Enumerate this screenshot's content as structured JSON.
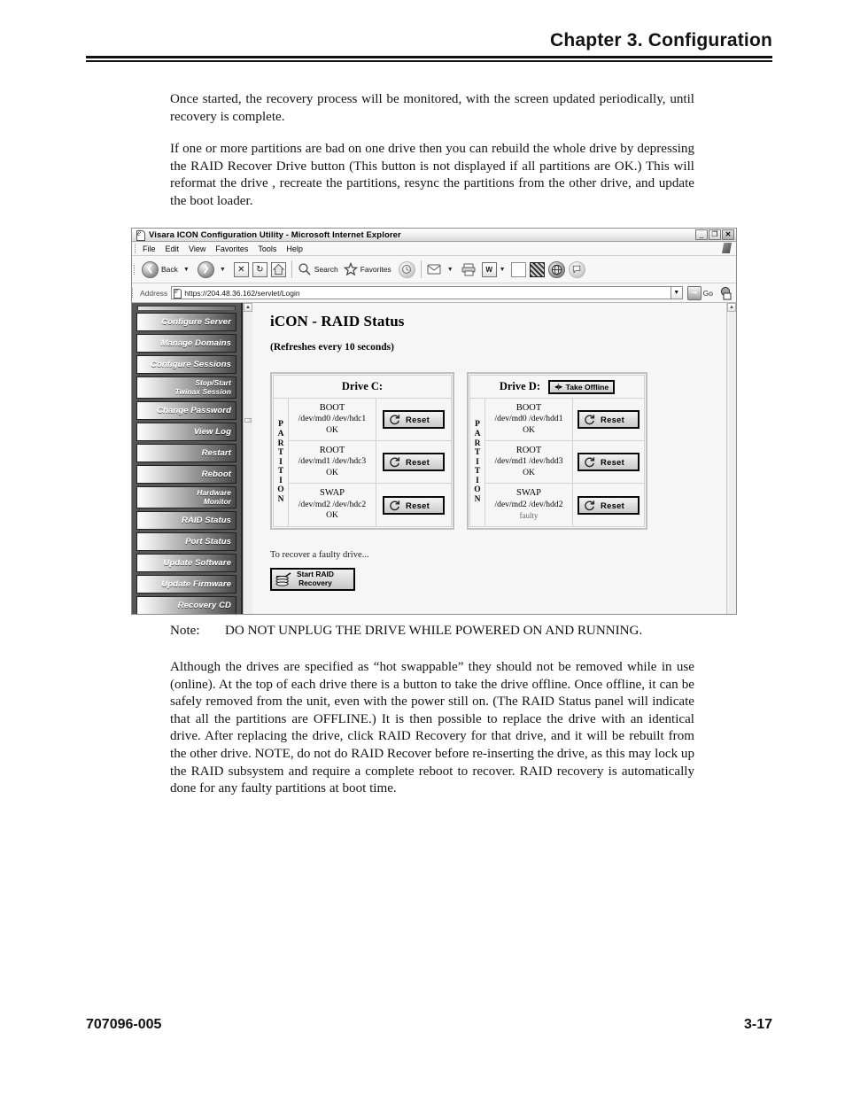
{
  "header": {
    "chapter_title": "Chapter 3.  Configuration"
  },
  "body": {
    "p1": "Once started, the recovery process will be monitored, with the screen updated periodically, until recovery is complete.",
    "p2": "If one or more partitions are bad on one drive then you can rebuild the whole drive by depressing the RAID Recover Drive button  (This button is not displayed if all partitions are OK.)  This will reformat the drive ,  recreate the partitions, resync the partitions from the other drive, and update the boot loader.",
    "note_label": "Note:",
    "note_text": "DO NOT UNPLUG THE DRIVE WHILE POWERED ON AND RUNNING.",
    "p3": "Although the drives are specified as “hot swappable” they should not be removed while in use (online). At the top of each drive there is a button to take the drive offline. Once offline, it can be safely removed from the unit, even with the power still on.  (The RAID Status panel will indicate that all the partitions are OFFLINE.)  It is then possible to replace the drive with an identical drive.  After replacing the drive, click RAID Recovery for that drive, and it will be rebuilt from the other drive. NOTE, do not do RAID Recover before re-inserting the drive, as this may lock up the RAID subsystem and require a complete reboot to recover.   RAID recovery is automatically done for any faulty partitions at boot time."
  },
  "footer": {
    "doc_number": "707096-005",
    "page_number": "3-17"
  },
  "browser": {
    "window_title": "Visara ICON Configuration Utility - Microsoft Internet Explorer",
    "window_buttons": {
      "minimize": "_",
      "restore": "❐",
      "close": "✕"
    },
    "menu": [
      "File",
      "Edit",
      "View",
      "Favorites",
      "Tools",
      "Help"
    ],
    "toolbar": {
      "back": "Back",
      "forward": "",
      "stop": "✕",
      "refresh": "↻",
      "home": "",
      "search": "Search",
      "favorites": "Favorites",
      "history": "",
      "mail": "",
      "print": "",
      "edit": "W",
      "discuss": "",
      "messenger": "",
      "research": ""
    },
    "address": {
      "label": "Address",
      "url": "https://204.48.36.162/servlet/Login",
      "go_label": "Go"
    }
  },
  "nav": {
    "items": [
      {
        "label": "Configure Server"
      },
      {
        "label": "Manage Domains"
      },
      {
        "label": "Configure Sessions"
      },
      {
        "label1": "Stop/Start",
        "label2": "Twinax Session"
      },
      {
        "label": "Change Password"
      },
      {
        "label": "View Log"
      },
      {
        "label": "Restart"
      },
      {
        "label": "Reboot"
      },
      {
        "label1": "Hardware",
        "label2": "Monitor"
      },
      {
        "label": "RAID Status"
      },
      {
        "label": "Port Status"
      },
      {
        "label": "Update Software"
      },
      {
        "label": "Update Firmware"
      },
      {
        "label": "Recovery CD"
      }
    ]
  },
  "app": {
    "title": "iCON - RAID Status",
    "subtitle": "(Refreshes every 10 seconds)",
    "partition_label_letters": [
      "P",
      "A",
      "R",
      "T",
      "I",
      "T",
      "I",
      "O",
      "N"
    ],
    "drives": [
      {
        "name": "Drive C:",
        "has_take_offline": false,
        "take_offline_label": "",
        "partitions": [
          {
            "name": "BOOT",
            "devices": "/dev/md0  /dev/hdc1",
            "status": "OK",
            "button": "Reset"
          },
          {
            "name": "ROOT",
            "devices": "/dev/md1  /dev/hdc3",
            "status": "OK",
            "button": "Reset"
          },
          {
            "name": "SWAP",
            "devices": "/dev/md2  /dev/hdc2",
            "status": "OK",
            "button": "Reset"
          }
        ]
      },
      {
        "name": "Drive D:",
        "has_take_offline": true,
        "take_offline_label": "Take Offline",
        "partitions": [
          {
            "name": "BOOT",
            "devices": "/dev/md0  /dev/hdd1",
            "status": "OK",
            "button": "Reset"
          },
          {
            "name": "ROOT",
            "devices": "/dev/md1  /dev/hdd3",
            "status": "OK",
            "button": "Reset"
          },
          {
            "name": "SWAP",
            "devices": "/dev/md2  /dev/hdd2",
            "status": "faulty",
            "button": "Reset"
          }
        ]
      }
    ],
    "recovery": {
      "caption": "To recover a faulty drive...",
      "button_line1": "Start RAID",
      "button_line2": "Recovery"
    }
  }
}
